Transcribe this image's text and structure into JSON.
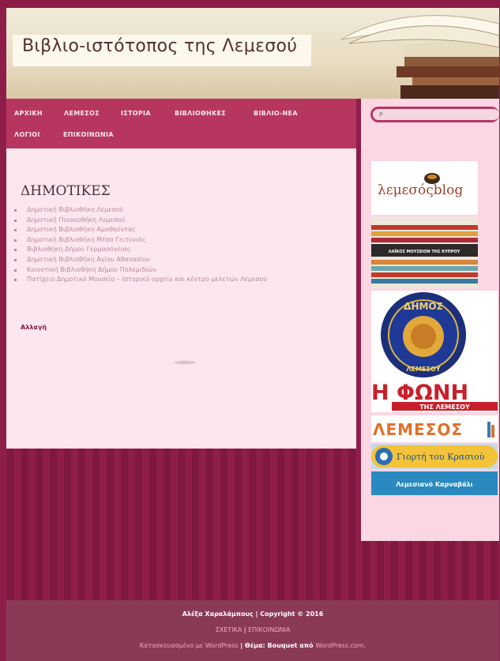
{
  "header": {
    "site_title": "Βιβλιο-ιστότοπος της Λεμεσού"
  },
  "nav": {
    "items": [
      {
        "label": "ΑΡΧΙΚΗ"
      },
      {
        "label": "ΛΕΜΕΣΟΣ"
      },
      {
        "label": "ΙΣΤΟΡΙΑ"
      },
      {
        "label": "ΒΙΒΛΙΟΘΗΚΕΣ"
      },
      {
        "label": "ΒΙΒΛΙΟ-ΝΕΑ"
      },
      {
        "label": "ΛΟΓΙΟΙ"
      },
      {
        "label": "ΕΠΙΚΟΙΝΩΝΙΑ"
      }
    ]
  },
  "search": {
    "placeholder": "P"
  },
  "main": {
    "heading": "ΔΗΜΟΤΙΚΕΣ",
    "links": [
      "Δημοτική Βιβλιοθήκη Λεμεσού",
      "Δημοτική Πινακοθήκη Λεμεσού",
      "Δημοτική Βιβλιοθήκη Αμαθούντας",
      "Δημοτική Βιβλιοθήκη Μέσα Γειτονιάς",
      "Βιβλιοθήκη Δήμου Γερμασόγειας",
      "Δημοτική Βιβλιοθήκη Αγίου Αθανασίου",
      "Κοινοτική Βιβλιοθήκη Δήμου Πολεμιδιών",
      "Πατίχειο Δημοτικό Μουσείο – Ιστορικό αρχείο και κέντρο μελετών Λεμεσού"
    ],
    "edit_label": "Αλλαγή"
  },
  "sidebar": {
    "badges": {
      "lemesos_blog": "λεμεσόςblog",
      "museum": "ΛΑΪΚΟΣ ΜΟΥΣΕΙΟΝ ΤΗΣ ΚΥΠΡΟΥ",
      "dimos_top": "ΔΗΜΟΣ",
      "dimos_bottom": "ΛΕΜΕΣΟΥ",
      "foni_main": "Η ΦΩΝΗ",
      "foni_sub": "ΤΗΣ ΛΕΜΕΣΟΥ",
      "lemesos": "ΛΕΜΕΣΟΣ",
      "krasi": "Γιορτή του Κρασιού",
      "karnavali": "Λεμεσιανό Καρναβάλι"
    }
  },
  "footer": {
    "author": "Αλέξα Χαραλάμπους",
    "sep": " | ",
    "copyright": "Copyright © 2016",
    "link_about": "ΣΧΕΤΙΚΑ",
    "link_contact": "ΕΠΙΚΟΙΝΩΝΙΑ",
    "built_with": "Κατασκευασμένο με WordPress",
    "theme_label": " | Θέμα: Bouquet από ",
    "theme_by": "WordPress.com",
    "period": "."
  },
  "colors": {
    "nav_bg": "#b7365f",
    "body_bg": "#8e1e49",
    "content_bg": "#fde7ee",
    "sidebar_bg": "#fbd6e3"
  }
}
